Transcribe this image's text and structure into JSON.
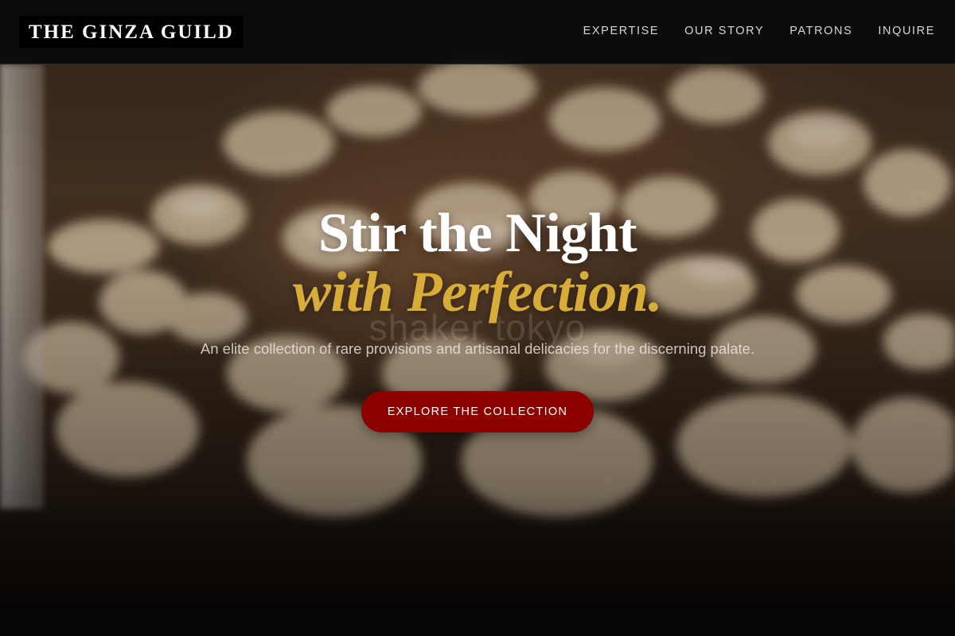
{
  "header": {
    "logo": "THE GINZA GUILD",
    "nav": [
      {
        "label": "EXPERTISE"
      },
      {
        "label": "OUR STORY"
      },
      {
        "label": "PATRONS"
      },
      {
        "label": "INQUIRE"
      }
    ]
  },
  "hero": {
    "headline_line1": "Stir the Night",
    "headline_line2": "with Perfection.",
    "watermark": "shaker tokyo",
    "tagline": "An elite collection of rare provisions and artisanal delicacies for the discerning palate.",
    "cta_label": "EXPLORE THE COLLECTION"
  },
  "colors": {
    "accent_gold": "#d8ac39",
    "cta_red": "#8c0000",
    "header_bg": "#0a0a0a"
  }
}
